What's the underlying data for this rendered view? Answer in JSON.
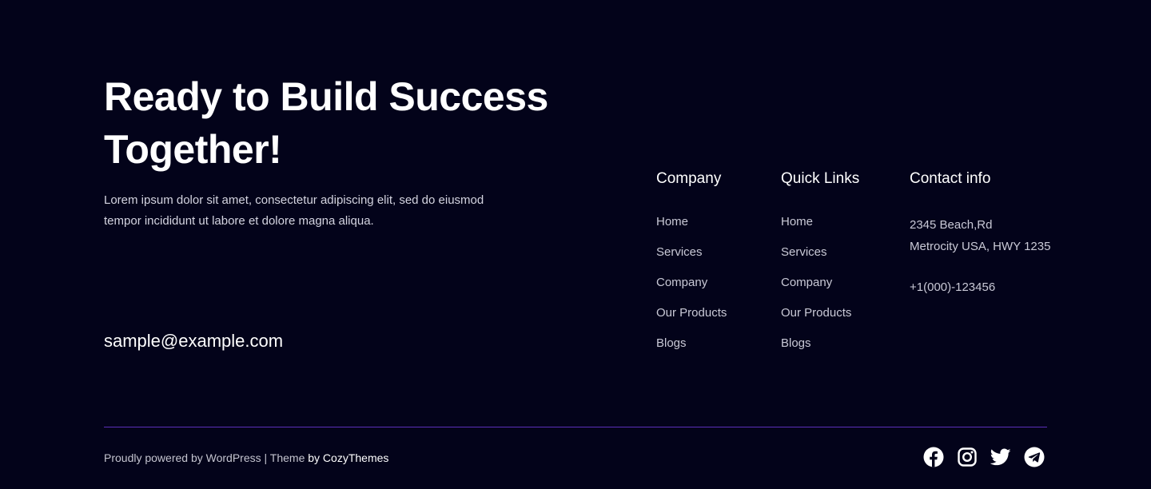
{
  "hero": {
    "headline": "Ready to Build Success Together!",
    "intro": "Lorem ipsum dolor sit amet, consectetur adipiscing elit, sed do eiusmod tempor incididunt ut labore et dolore magna aliqua.",
    "email": "sample@example.com"
  },
  "company": {
    "heading": "Company",
    "links": [
      "Home",
      "Services",
      "Company",
      "Our Products",
      "Blogs"
    ]
  },
  "quick_links": {
    "heading": "Quick Links",
    "links": [
      "Home",
      "Services",
      "Company",
      "Our Products",
      "Blogs"
    ]
  },
  "contact": {
    "heading": "Contact info",
    "address_line1": "2345 Beach,Rd",
    "address_line2": "Metrocity USA, HWY 1235",
    "phone": "+1(000)-123456"
  },
  "bottom_bar": {
    "powered_by": "Proudly powered by WordPress",
    "separator": " | ",
    "theme_prefix": "Theme ",
    "theme_brand": "by CozyThemes",
    "social": [
      {
        "name": "facebook-icon"
      },
      {
        "name": "instagram-icon"
      },
      {
        "name": "twitter-icon"
      },
      {
        "name": "telegram-icon"
      }
    ],
    "divider_color": "#5b2fb8"
  },
  "colors": {
    "background": "#03031a",
    "text": "#ffffff",
    "muted_text": "#c9c9d6"
  }
}
